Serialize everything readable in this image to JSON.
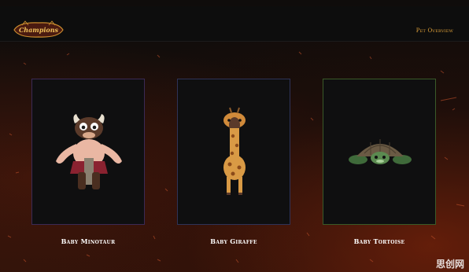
{
  "header": {
    "logo_text": "Champions",
    "nav_link": "Pet Overview"
  },
  "pets": [
    {
      "name": "Baby Minotaur",
      "border_color": "#3b2a55"
    },
    {
      "name": "Baby Giraffe",
      "border_color": "#2e3358"
    },
    {
      "name": "Baby Tortoise",
      "border_color": "#3a5a28"
    }
  ],
  "watermark": "思创网"
}
